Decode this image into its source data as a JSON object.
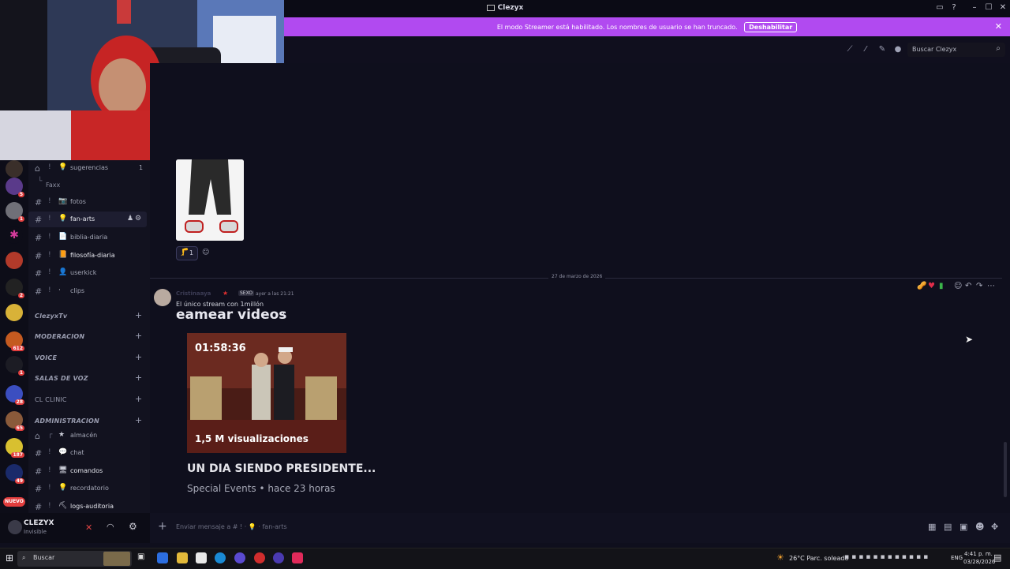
{
  "window": {
    "title": "Clezyx"
  },
  "banner": {
    "message": "El modo Streamer está habilitado. Los nombres de usuario se han truncado.",
    "button": "Deshabilitar"
  },
  "header": {
    "search_placeholder": "Buscar Clezyx"
  },
  "channels": {
    "sugerencias": {
      "name": "sugerencias",
      "count": "1"
    },
    "thread": "Faxx",
    "fotos": "fotos",
    "fan_arts": "fan-arts",
    "biblia": "biblia-diaria",
    "filosofia": "filosofía-diaria",
    "userkick": "userkick",
    "clips": "clips",
    "admin_almacen": "almacén",
    "admin_chat": "chat",
    "admin_comandos": "comandos",
    "admin_recordatorio": "recordatorio",
    "admin_logs": "logs-auditoria"
  },
  "categories": {
    "clezyxtv": "ClezyxTv",
    "moderacion": "MODERACION",
    "voice": "VOICE",
    "salas": "SALAS DE VOZ",
    "clinic": "CL CLINIC",
    "admin": "ADMINISTRACION"
  },
  "servers": {
    "badges": [
      "5",
      "1",
      "2",
      "612",
      "1",
      "28",
      "65",
      "187",
      "49"
    ],
    "new_label": "NUEVO"
  },
  "user": {
    "name": "CLEZYX",
    "status": "Invisible"
  },
  "messages": {
    "reaction_count": "1",
    "date_divider": "27 de marzo de 2026",
    "author": "Cristinaaya",
    "role_tag": "SEXO",
    "time": "ayer a las 21:21",
    "text": "El único stream con 1millón",
    "embed_header": "eamear videos",
    "video": {
      "duration": "01:58:36",
      "views": "1,5 M visualizaciones",
      "title": "UN DIA SIENDO PRESIDENTE...",
      "subtitle": "Special Events • hace 23 horas"
    }
  },
  "composer": {
    "placeholder": "Enviar mensaje a # ! · 💡 · fan-arts"
  },
  "taskbar": {
    "search": "Buscar",
    "weather": "26°C  Parc. soleado",
    "lang": "ENG",
    "time": "4:41 p. m.",
    "date": "03/28/2026"
  },
  "colors": {
    "accent": "#b14af0",
    "background": "#0f0f1d",
    "sidebar": "#12121f"
  }
}
